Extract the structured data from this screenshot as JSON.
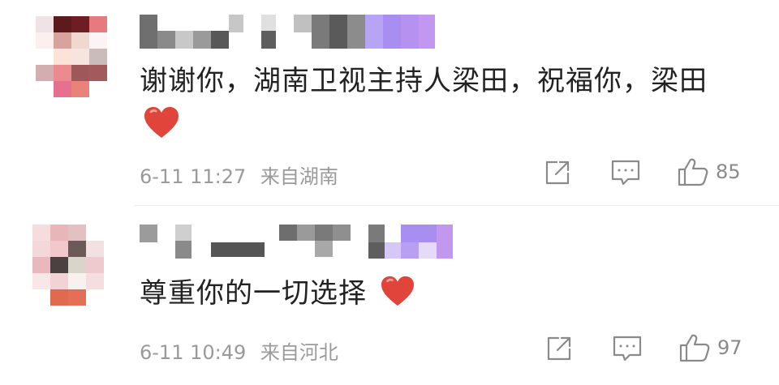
{
  "comments": [
    {
      "text": "谢谢你，湖南卫视主持人梁田，祝福你，梁田",
      "timestamp": "6-11 11:27",
      "location": "来自湖南",
      "likes": "85",
      "icons": [
        "heart-emoji",
        "share-icon",
        "comment-icon",
        "thumbs-up-icon"
      ]
    },
    {
      "text": "尊重你的一切选择",
      "timestamp": "6-11 10:49",
      "location": "来自河北",
      "likes": "97",
      "icons": [
        "heart-emoji",
        "share-icon",
        "comment-icon",
        "thumbs-up-icon"
      ]
    }
  ],
  "colors": {
    "text": "#222222",
    "meta": "#9a9a9a",
    "heart": "#e0443a",
    "icon": "#8a8a8a"
  }
}
